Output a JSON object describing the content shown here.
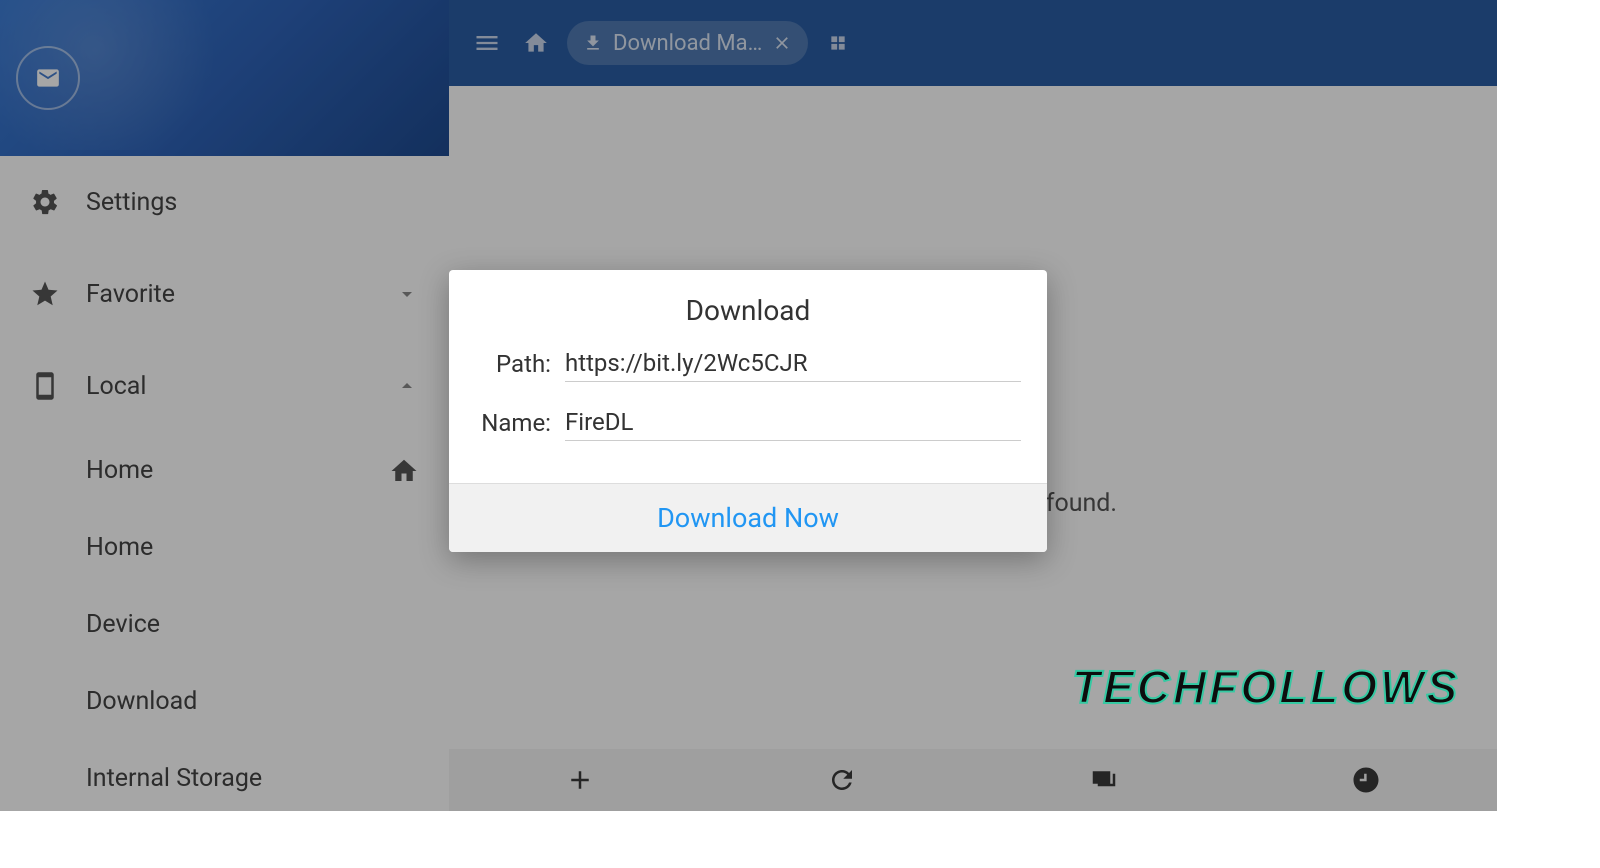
{
  "sidebar": {
    "items": [
      {
        "label": "Settings"
      },
      {
        "label": "Favorite"
      },
      {
        "label": "Local"
      }
    ],
    "subitems": [
      {
        "label": "Home"
      },
      {
        "label": "Home"
      },
      {
        "label": "Device"
      },
      {
        "label": "Download"
      },
      {
        "label": "Internal Storage"
      }
    ]
  },
  "tab": {
    "label": "Download Ma…"
  },
  "content": {
    "status": "found."
  },
  "modal": {
    "title": "Download",
    "path_label": "Path:",
    "path_value": "https://bit.ly/2Wc5CJR",
    "name_label": "Name:",
    "name_value": "FireDL",
    "action": "Download Now"
  },
  "watermark": "TECHFOLLOWS"
}
